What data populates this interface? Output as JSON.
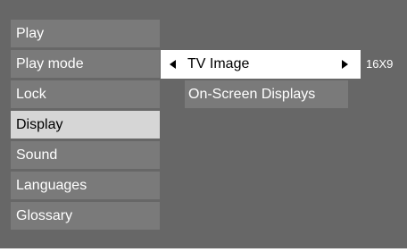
{
  "menu": {
    "items": [
      {
        "label": "Play"
      },
      {
        "label": "Play mode"
      },
      {
        "label": "Lock"
      },
      {
        "label": "Display",
        "selected": true
      },
      {
        "label": "Sound"
      },
      {
        "label": "Languages"
      },
      {
        "label": "Glossary"
      }
    ]
  },
  "submenu": {
    "tv_image": {
      "label": "TV Image",
      "value": "16X9"
    },
    "osd": {
      "label": "On-Screen Displays"
    }
  },
  "colors": {
    "background": "#676767",
    "item": "#7a7a7a",
    "selected": "#d6d6d6",
    "highlight": "#ffffff"
  },
  "icons": [
    "arrow-left-icon",
    "arrow-right-icon"
  ]
}
